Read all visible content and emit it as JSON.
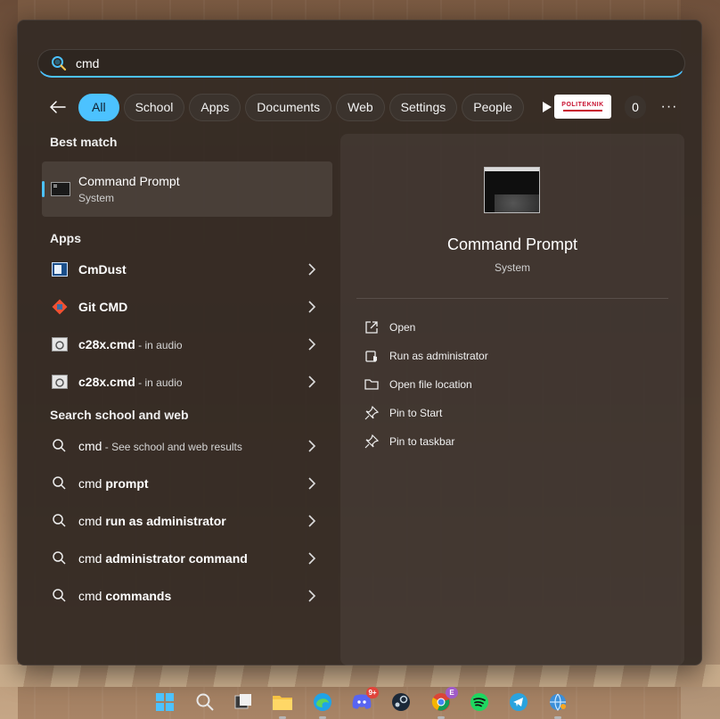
{
  "search": {
    "query": "cmd"
  },
  "filters": [
    {
      "label": "All",
      "active": true
    },
    {
      "label": "School"
    },
    {
      "label": "Apps"
    },
    {
      "label": "Documents"
    },
    {
      "label": "Web"
    },
    {
      "label": "Settings"
    },
    {
      "label": "People"
    }
  ],
  "header_extra": {
    "org_logo_text": "POLITEKNIK",
    "count": "0",
    "more": "···"
  },
  "best_match": {
    "title": "Best match",
    "name": "Command Prompt",
    "type": "System"
  },
  "apps": {
    "title": "Apps",
    "items": [
      {
        "name": "CmDust",
        "suffix": "",
        "icon": "cmdust-icon"
      },
      {
        "name": "Git CMD",
        "suffix": "",
        "icon": "git-cmd-icon"
      },
      {
        "name": "c28x.cmd",
        "suffix": " - in audio",
        "icon": "cmd-file-icon"
      },
      {
        "name": "c28x.cmd",
        "suffix": " - in audio",
        "icon": "cmd-file-icon"
      }
    ]
  },
  "web": {
    "title": "Search school and web",
    "items": [
      {
        "prefix": "cmd",
        "bold": "",
        "suffix": " - See school and web results"
      },
      {
        "prefix": "cmd ",
        "bold": "prompt",
        "suffix": ""
      },
      {
        "prefix": "cmd ",
        "bold": "run as administrator",
        "suffix": ""
      },
      {
        "prefix": "cmd ",
        "bold": "administrator command",
        "suffix": ""
      },
      {
        "prefix": "cmd ",
        "bold": "commands",
        "suffix": ""
      }
    ]
  },
  "preview": {
    "title": "Command Prompt",
    "subtitle": "System",
    "actions": [
      {
        "label": "Open",
        "icon": "open-external-icon"
      },
      {
        "label": "Run as administrator",
        "icon": "shield-run-icon"
      },
      {
        "label": "Open file location",
        "icon": "folder-icon"
      },
      {
        "label": "Pin to Start",
        "icon": "pin-icon"
      },
      {
        "label": "Pin to taskbar",
        "icon": "pin-icon"
      }
    ]
  },
  "taskbar": {
    "discord_badge": "9+",
    "chrome_badge": "E"
  },
  "colors": {
    "accent": "#4cc2ff",
    "panel": "#342a24"
  }
}
